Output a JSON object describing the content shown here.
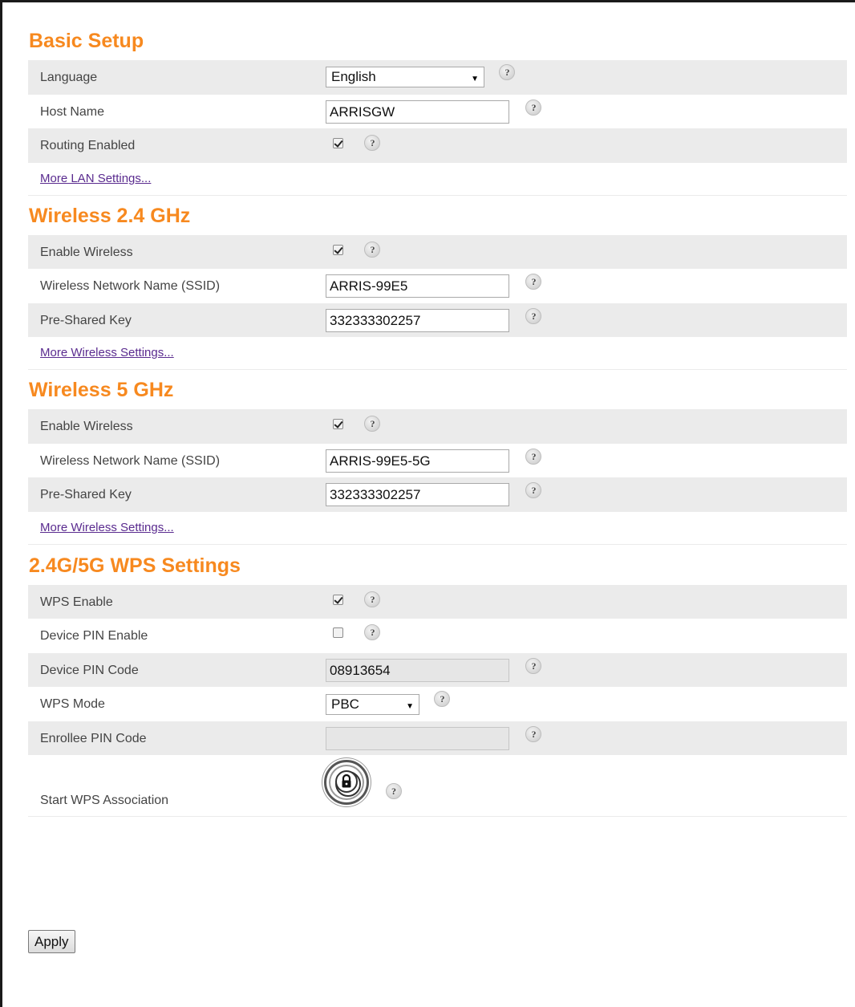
{
  "basic_setup": {
    "title": "Basic Setup",
    "language_label": "Language",
    "language_value": "English",
    "hostname_label": "Host Name",
    "hostname_value": "ARRISGW",
    "routing_label": "Routing Enabled",
    "routing_checked": true,
    "more_link": "More LAN Settings..."
  },
  "wireless_24": {
    "title": "Wireless 2.4 GHz",
    "enable_label": "Enable Wireless",
    "enable_checked": true,
    "ssid_label": "Wireless Network Name (SSID)",
    "ssid_value": "ARRIS-99E5",
    "psk_label": "Pre-Shared Key",
    "psk_value": "332333302257",
    "more_link": "More Wireless Settings..."
  },
  "wireless_5": {
    "title": "Wireless 5 GHz",
    "enable_label": "Enable Wireless",
    "enable_checked": true,
    "ssid_label": "Wireless Network Name (SSID)",
    "ssid_value": "ARRIS-99E5-5G",
    "psk_label": "Pre-Shared Key",
    "psk_value": "332333302257",
    "more_link": "More Wireless Settings..."
  },
  "wps": {
    "title": "2.4G/5G WPS Settings",
    "enable_label": "WPS Enable",
    "enable_checked": true,
    "device_pin_enable_label": "Device PIN Enable",
    "device_pin_enable_checked": false,
    "device_pin_code_label": "Device PIN Code",
    "device_pin_code_value": "08913654",
    "mode_label": "WPS Mode",
    "mode_value": "PBC",
    "enrollee_pin_label": "Enrollee PIN Code",
    "enrollee_pin_value": "",
    "start_label": "Start WPS Association",
    "start_icon": "lock-icon"
  },
  "help_glyph": "?",
  "select_arrow": "▼",
  "apply_label": "Apply",
  "colors": {
    "section_title": "#f7891f",
    "row_shade": "#ebebeb",
    "link": "#5a2b8f"
  }
}
